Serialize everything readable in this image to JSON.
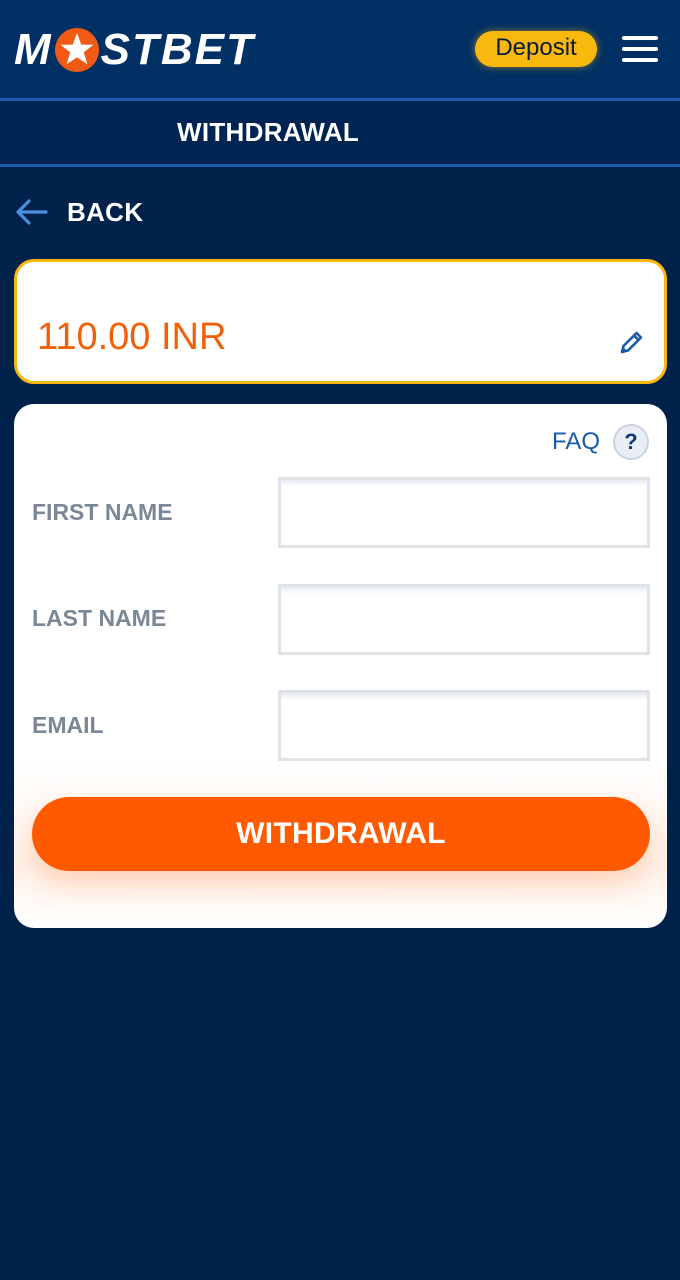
{
  "header": {
    "logo_pre": "M",
    "logo_post": "STBET",
    "deposit_label": "Deposit",
    "menu_icon": "hamburger-icon"
  },
  "page": {
    "title": "WITHDRAWAL",
    "back_label": "BACK",
    "back_icon": "arrow-left-icon"
  },
  "amount": {
    "value": "110.00 INR",
    "edit_icon": "pencil-icon"
  },
  "form": {
    "faq_label": "FAQ",
    "help_icon_glyph": "?",
    "fields": [
      {
        "label": "FIRST NAME",
        "value": ""
      },
      {
        "label": "LAST NAME",
        "value": ""
      },
      {
        "label": "EMAIL",
        "value": ""
      }
    ],
    "submit_label": "WITHDRAWAL"
  },
  "colors": {
    "background": "#00224a",
    "header": "#003064",
    "accent_yellow": "#f9b80d",
    "accent_orange": "#ff5a00",
    "link_blue": "#1a5ba8"
  }
}
